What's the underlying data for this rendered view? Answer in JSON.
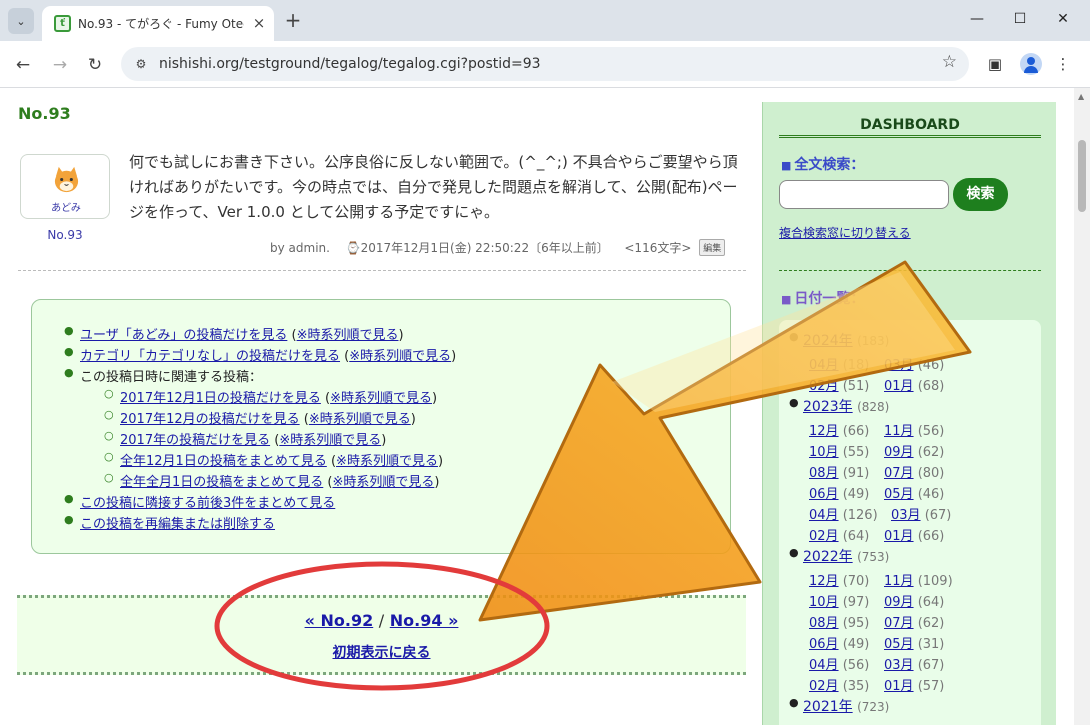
{
  "browser": {
    "tab_title": "No.93 - てがろぐ - Fumy Otegaru",
    "tab_close": "×",
    "new_tab": "+",
    "tab_menu": "⌄",
    "url": "nishishi.org/testground/tegalog/tegalog.cgi?postid=93",
    "window": {
      "minimize": "—",
      "maximize": "☐",
      "close": "✕"
    },
    "nav": {
      "back": "←",
      "forward": "→",
      "reload": "↻"
    },
    "icons": [
      "tab-search-icon",
      "site-info-icon",
      "star-icon",
      "side-panel-icon",
      "profile-icon",
      "menu-icon"
    ]
  },
  "post": {
    "number": "No.93",
    "avatar_name": "あどみ",
    "body": "何でも試しにお書き下さい。公序良俗に反しない範囲で。(^_^;) 不具合やらご要望やら頂ければありがたいです。今の時点では、自分で発見した問題点を解消して、公開(配布)ページを作って、Ver 1.0.0 として公開する予定ですにゃ。",
    "by": "by admin.",
    "datetime": "2017年12月1日(金) 22:50:22〔6年以上前〕",
    "chars": "<116文字>",
    "edit": "編集"
  },
  "links": {
    "user_link": "ユーザ「あどみ」の投稿だけを見る",
    "user_chrono": "※時系列順で見る",
    "cat_link": "カテゴリ「カテゴリなし」の投稿だけを見る",
    "cat_chrono": "※時系列順で見る",
    "related_label": "この投稿日時に関連する投稿：",
    "day_link": "2017年12月1日の投稿だけを見る",
    "day_chrono": "※時系列順で見る",
    "month_link": "2017年12月の投稿だけを見る",
    "month_chrono": "※時系列順で見る",
    "year_link": "2017年の投稿だけを見る",
    "year_chrono": "※時系列順で見る",
    "allyear_day_link": "全年12月1日の投稿をまとめて見る",
    "allyear_day_chrono": "※時系列順で見る",
    "allyear_month_link": "全年全月1日の投稿をまとめて見る",
    "allyear_month_chrono": "※時系列順で見る",
    "adjacent_link": "この投稿に隣接する前後3件をまとめて見る",
    "edit_link": "この投稿を再編集または削除する"
  },
  "pager": {
    "prev": "« No.92",
    "sep": "/",
    "next": "No.94 »",
    "back": "初期表示に戻る"
  },
  "sidebar": {
    "title": "DASHBOARD",
    "search_head": "全文検索：",
    "search_button": "検索",
    "switch_link": "複合検索窓に切り替える",
    "date_head": "日付一覧：",
    "years": [
      {
        "label": "2024年",
        "count": "(183)"
      },
      {
        "label": "2023年",
        "count": "(828)"
      },
      {
        "label": "2022年",
        "count": "(753)"
      },
      {
        "label": "2021年",
        "count": "(723)"
      }
    ],
    "months_2024": [
      {
        "m": "04月",
        "c": "(18)"
      },
      {
        "m": "03月",
        "c": "(46)"
      },
      {
        "m": "02月",
        "c": "(51)"
      },
      {
        "m": "01月",
        "c": "(68)"
      }
    ],
    "months_2023": [
      {
        "m": "12月",
        "c": "(66)"
      },
      {
        "m": "11月",
        "c": "(56)"
      },
      {
        "m": "10月",
        "c": "(55)"
      },
      {
        "m": "09月",
        "c": "(62)"
      },
      {
        "m": "08月",
        "c": "(91)"
      },
      {
        "m": "07月",
        "c": "(80)"
      },
      {
        "m": "06月",
        "c": "(49)"
      },
      {
        "m": "05月",
        "c": "(46)"
      },
      {
        "m": "04月",
        "c": "(126)"
      },
      {
        "m": "03月",
        "c": "(67)"
      },
      {
        "m": "02月",
        "c": "(64)"
      },
      {
        "m": "01月",
        "c": "(66)"
      }
    ],
    "months_2022": [
      {
        "m": "12月",
        "c": "(70)"
      },
      {
        "m": "11月",
        "c": "(109)"
      },
      {
        "m": "10月",
        "c": "(97)"
      },
      {
        "m": "09月",
        "c": "(64)"
      },
      {
        "m": "08月",
        "c": "(95)"
      },
      {
        "m": "07月",
        "c": "(62)"
      },
      {
        "m": "06月",
        "c": "(49)"
      },
      {
        "m": "05月",
        "c": "(31)"
      },
      {
        "m": "04月",
        "c": "(56)"
      },
      {
        "m": "03月",
        "c": "(67)"
      },
      {
        "m": "02月",
        "c": "(35)"
      },
      {
        "m": "01月",
        "c": "(57)"
      }
    ]
  },
  "colors": {
    "accent_green": "#2e7d1e",
    "link_blue": "#1a1aa8",
    "sidebar_bg": "#cfefcf",
    "arrow_orange": "#f5a41c",
    "circle_red": "#e23b3b"
  }
}
